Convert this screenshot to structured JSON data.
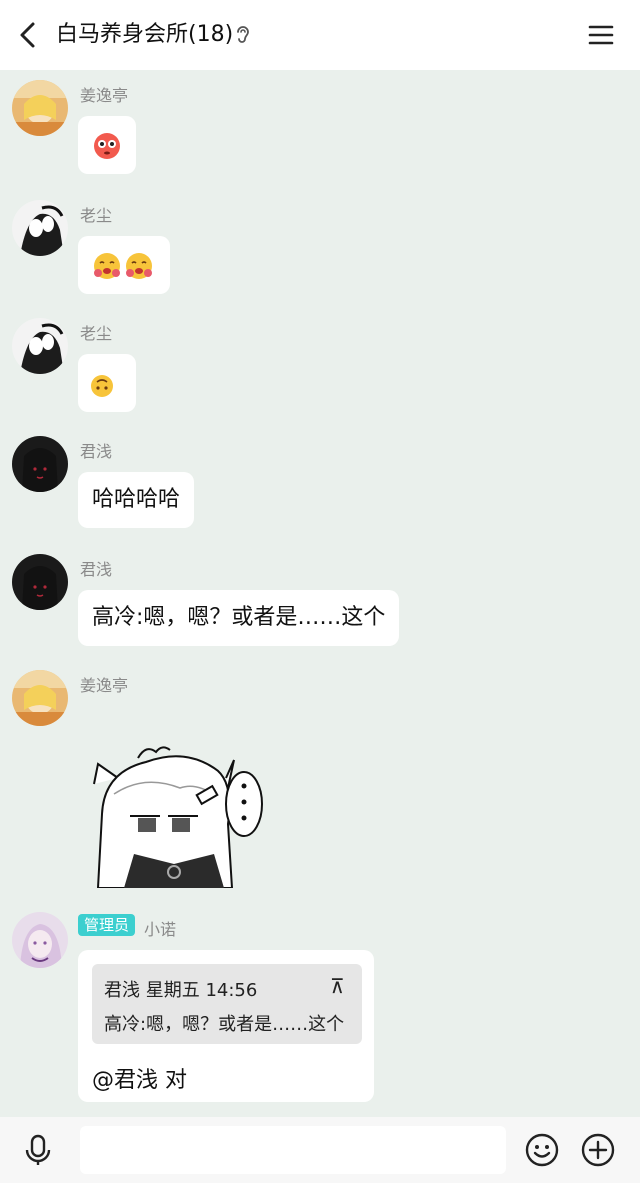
{
  "header": {
    "title": "白马养身会所(18)"
  },
  "messages": [
    {
      "sender": "姜逸亭",
      "content": "😳"
    },
    {
      "sender": "老尘",
      "content": "🥰🥰"
    },
    {
      "sender": "老尘",
      "content": "🙃"
    },
    {
      "sender": "君浅",
      "text": "哈哈哈哈"
    },
    {
      "sender": "君浅",
      "text": "高冷:嗯，嗯？或者是……这个"
    },
    {
      "sender": "姜逸亭",
      "content": "sticker"
    },
    {
      "badge": "管理员",
      "sender": "小诺",
      "quote": {
        "header": "君浅 星期五 14:56",
        "arrow": "⊼",
        "text": "高冷:嗯，嗯？或者是……这个"
      },
      "text": "@君浅 对"
    }
  ],
  "colors": {
    "chat_bg": "#EAF0EC",
    "admin_badge": "#3CCFCF",
    "bubble": "#FFFFFF"
  },
  "icons": [
    "back-icon",
    "ear-icon",
    "menu-icon",
    "microphone-icon",
    "emoji-icon",
    "plus-icon"
  ]
}
